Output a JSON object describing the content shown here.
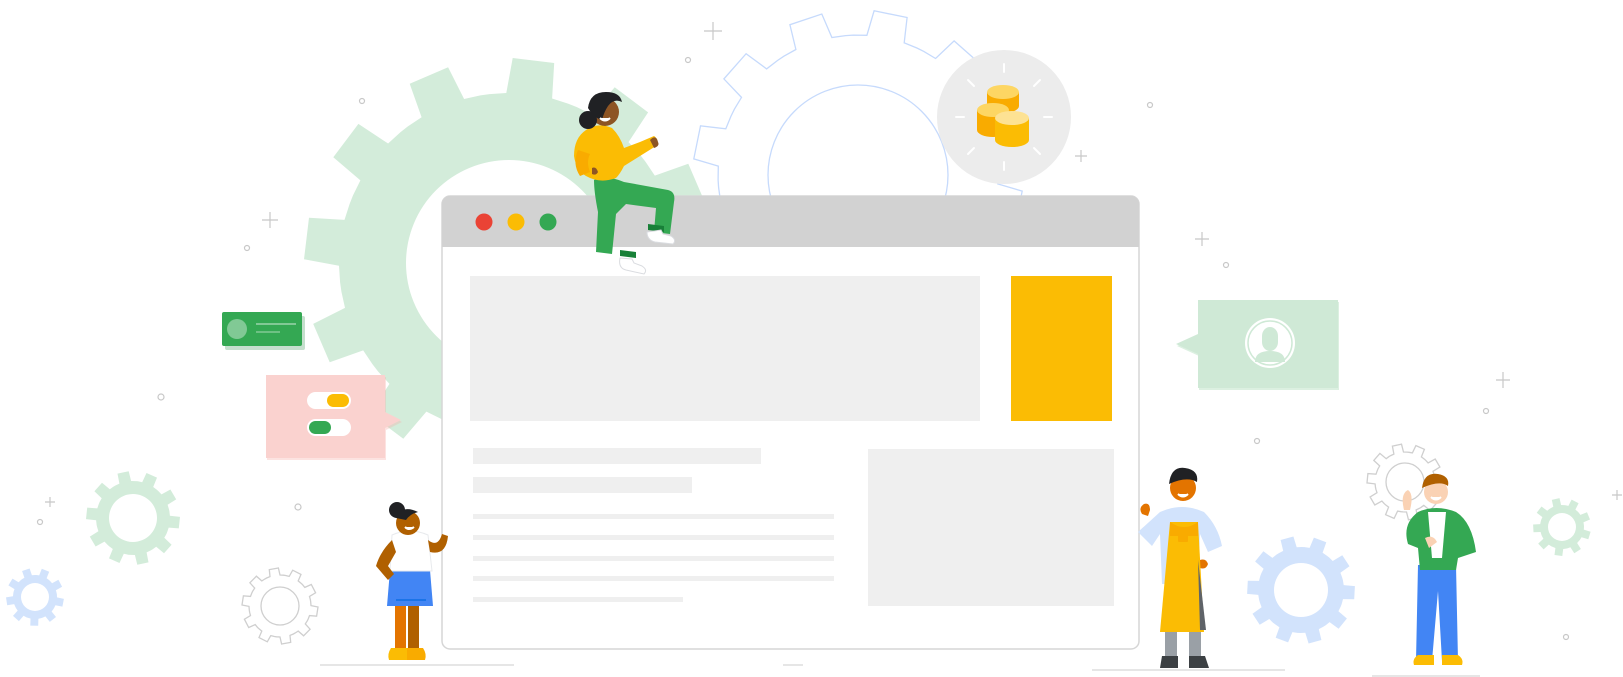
{
  "palette": {
    "gear_green": "#d3ecda",
    "gear_blue": "#d2e3fc",
    "gear_outline": "#c6dafc",
    "browser_chrome": "#d2d2d2",
    "placeholder": "#efefef",
    "accent_yellow": "#fbbc04",
    "google_red": "#ea4335",
    "google_yellow": "#fbbc04",
    "google_green": "#34a853",
    "google_blue": "#4285f4",
    "bubble_pink": "#fad2cf",
    "bubble_green": "#cfe9d6",
    "coin_bg": "#ececec",
    "sparkle": "#c4c4c4"
  },
  "icons": {
    "coin": "coins-stack-icon",
    "profile": "person-avatar-icon",
    "toggles": "toggle-switches-icon",
    "message": "message-card-icon"
  },
  "browser": {
    "window_buttons": [
      "close",
      "minimize",
      "maximize"
    ]
  }
}
